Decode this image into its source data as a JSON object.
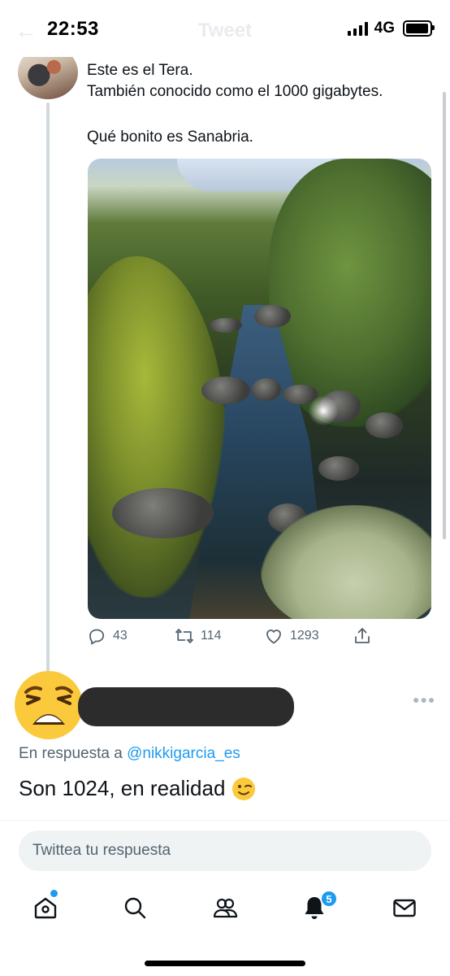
{
  "status_bar": {
    "time": "22:53",
    "network": "4G",
    "ghost_title": "Tweet"
  },
  "tweet": {
    "lines": [
      "Este es el Tera.",
      "También conocido como el 1000 gigabytes.",
      "Qué bonito es Sanabria."
    ],
    "stats": {
      "replies": "43",
      "retweets": "114",
      "likes": "1293"
    }
  },
  "reply": {
    "emoji": "😩",
    "reply_prefix": "En respuesta a",
    "reply_handle": "@nikkigarcia_es",
    "text": "Son 1024, en realidad",
    "text_emoji": "😉"
  },
  "composer": {
    "placeholder": "Twittea tu respuesta"
  },
  "tabbar": {
    "notifications_badge": "5"
  },
  "colors": {
    "accent": "#1d9bf0",
    "muted": "#536471",
    "text": "#0f1419"
  }
}
